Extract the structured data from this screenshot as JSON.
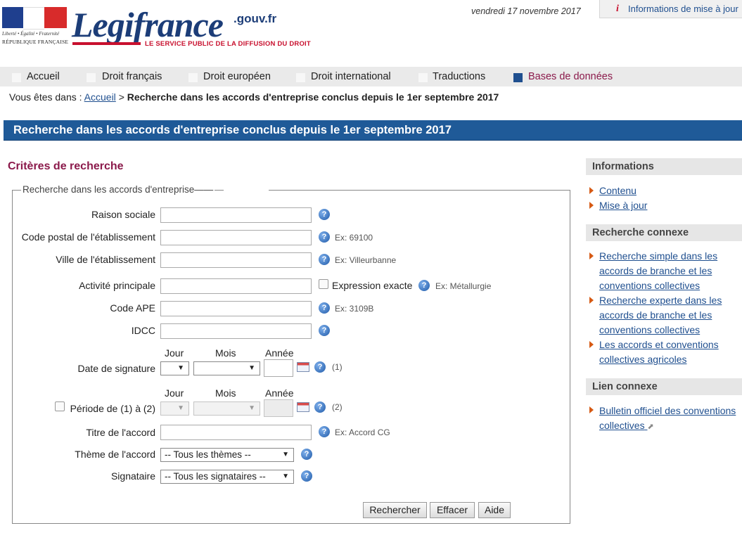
{
  "header": {
    "motto": "Liberté • Égalité • Fraternité",
    "republic": "RÉPUBLIQUE FRANÇAISE",
    "brand": "Legifrance",
    "brand_suffix": ".gouv.fr",
    "tagline": "LE SERVICE PUBLIC DE LA DIFFUSION DU DROIT",
    "date": "vendredi 17 novembre 2017",
    "info_tab": "Informations de mise à jour",
    "colors": {
      "brand_blue": "#1c3d78",
      "brand_red": "#c8102e"
    }
  },
  "nav": {
    "items": [
      {
        "label": "Accueil"
      },
      {
        "label": "Droit français"
      },
      {
        "label": "Droit européen"
      },
      {
        "label": "Droit international"
      },
      {
        "label": "Traductions"
      },
      {
        "label": "Bases de données",
        "active": true
      }
    ]
  },
  "breadcrumb": {
    "prefix": "Vous êtes dans :",
    "home": "Accueil",
    "separator": ">",
    "current": "Recherche dans les accords d'entreprise conclus depuis le 1er septembre 2017"
  },
  "page": {
    "title": "Recherche dans les accords d'entreprise conclus depuis le 1er septembre 2017",
    "criteria_title": "Critères de recherche",
    "fieldset_legend": "Recherche dans les accords d'entreprise——"
  },
  "form": {
    "raison_sociale": {
      "label": "Raison sociale",
      "value": ""
    },
    "code_postal": {
      "label": "Code postal de l'établissement",
      "value": "",
      "example": "Ex: 69100"
    },
    "ville": {
      "label": "Ville de l'établissement",
      "value": "",
      "example": "Ex: Villeurbanne"
    },
    "activite": {
      "label": "Activité principale",
      "value": "",
      "checkbox_label": "Expression exacte",
      "example": "Ex: Métallurgie"
    },
    "code_ape": {
      "label": "Code APE",
      "value": "",
      "example": "Ex: 3109B"
    },
    "idcc": {
      "label": "IDCC",
      "value": ""
    },
    "date_headers": {
      "jour": "Jour",
      "mois": "Mois",
      "annee": "Année"
    },
    "date_signature": {
      "label": "Date de signature",
      "note": "(1)"
    },
    "periode": {
      "label": "Période de (1) à (2)",
      "note": "(2)"
    },
    "titre": {
      "label": "Titre de l'accord",
      "value": "",
      "example": "Ex: Accord CG"
    },
    "theme": {
      "label": "Thème de l'accord",
      "selected": "-- Tous les thèmes --"
    },
    "signataire": {
      "label": "Signataire",
      "selected": "-- Tous les signataires --"
    },
    "help_glyph": "?",
    "buttons": {
      "search": "Rechercher",
      "clear": "Effacer",
      "help": "Aide"
    }
  },
  "sidebar": {
    "informations": {
      "title": "Informations",
      "links": [
        "Contenu",
        "Mise à jour"
      ]
    },
    "recherche_connexe": {
      "title": "Recherche connexe",
      "links": [
        "Recherche simple dans les accords de branche et les conventions collectives",
        "Recherche experte dans les accords de branche et les conventions collectives",
        "Les accords et conventions collectives agricoles"
      ]
    },
    "lien_connexe": {
      "title": "Lien connexe",
      "links": [
        "Bulletin officiel des conventions collectives"
      ]
    }
  },
  "icons": {
    "help": "help-icon",
    "calendar": "calendar-icon",
    "external": "external-link-icon",
    "bullet": "triangle-bullet-icon"
  }
}
